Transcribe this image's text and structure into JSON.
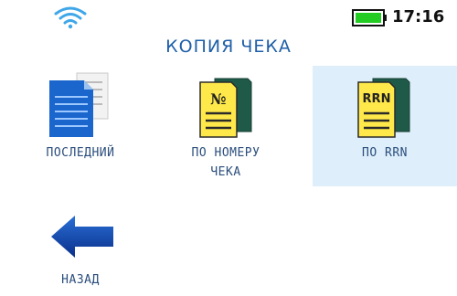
{
  "status_bar": {
    "wifi_icon": "wifi-icon",
    "battery_icon": "battery-icon",
    "battery_color": "#22cc22",
    "time": "17:16"
  },
  "screen": {
    "title": "КОПИЯ ЧЕКА"
  },
  "menu": {
    "items": [
      {
        "label": "ПОСЛЕДНИЙ",
        "icon": "document-icon",
        "selected": false
      },
      {
        "label_line1": "ПО НОМЕРУ",
        "label_line2": "ЧЕКА",
        "icon": "receipt-number-icon",
        "icon_text": "№",
        "selected": false
      },
      {
        "label": "ПО RRN",
        "icon": "receipt-rrn-icon",
        "icon_text": "RRN",
        "selected": true
      },
      {
        "label": "НАЗАД",
        "icon": "arrow-left-icon",
        "selected": false
      }
    ]
  },
  "colors": {
    "title": "#1f5fa8",
    "label": "#2b4e7c",
    "selected_bg": "#deeefa"
  }
}
